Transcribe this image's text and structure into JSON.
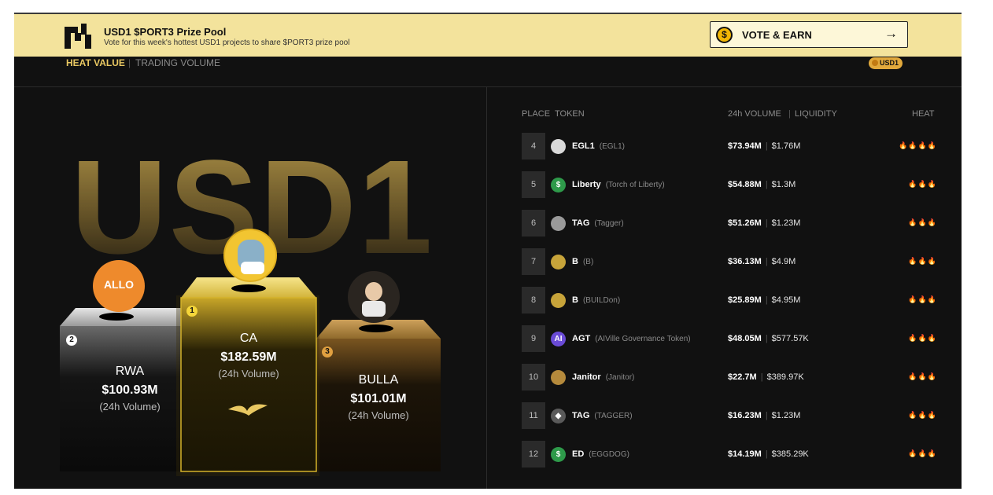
{
  "banner": {
    "title": "USD1 $PORT3 Prize Pool",
    "subtitle": "Vote for this week's hottest USD1 projects to share $PORT3 prize pool",
    "vote_coin": "$",
    "vote_label": "VOTE & EARN",
    "vote_arrow": "→"
  },
  "tabs": {
    "heat": "HEAT VALUE",
    "separator": "|",
    "volume": "TRADING VOLUME"
  },
  "badge": {
    "label": "USD1"
  },
  "hero_text": "USD1",
  "podium": [
    {
      "rank": "2",
      "name": "RWA",
      "value": "$100.93M",
      "sub": "(24h Volume)",
      "avatar_text": "ALLO"
    },
    {
      "rank": "1",
      "name": "CA",
      "value": "$182.59M",
      "sub": "(24h Volume)"
    },
    {
      "rank": "3",
      "name": "BULLA",
      "value": "$101.01M",
      "sub": "(24h Volume)"
    }
  ],
  "colors": {
    "banner_bg": "#f3e39c",
    "accent_gold": "#e9c862",
    "heat": "#f07a1c"
  },
  "table": {
    "headers": {
      "place": "PLACE",
      "token": "TOKEN",
      "volume": "24h VOLUME",
      "sep": "|",
      "liquidity": "LIQUIDITY",
      "heat": "HEAT"
    },
    "rows": [
      {
        "place": "4",
        "icon": "eagle-icon",
        "icon_color": "#d9d9d9",
        "icon_glyph": "",
        "symbol": "EGL1",
        "full": "(EGL1)",
        "volume": "$73.94M",
        "liquidity": "$1.76M",
        "heat": "🔥🔥🔥🔥"
      },
      {
        "place": "5",
        "icon": "dollar-icon",
        "icon_color": "#2e9a4a",
        "icon_glyph": "$",
        "symbol": "Liberty",
        "full": "(Torch of Liberty)",
        "volume": "$54.88M",
        "liquidity": "$1.3M",
        "heat": "🔥🔥🔥"
      },
      {
        "place": "6",
        "icon": "robot-icon",
        "icon_color": "#9a9a9a",
        "icon_glyph": "",
        "symbol": "TAG",
        "full": "(Tagger)",
        "volume": "$51.26M",
        "liquidity": "$1.23M",
        "heat": "🔥🔥🔥"
      },
      {
        "place": "7",
        "icon": "builder-icon",
        "icon_color": "#c7a43a",
        "icon_glyph": "",
        "symbol": "B",
        "full": "(B)",
        "volume": "$36.13M",
        "liquidity": "$4.9M",
        "heat": "🔥🔥🔥"
      },
      {
        "place": "8",
        "icon": "builder-icon",
        "icon_color": "#c7a43a",
        "icon_glyph": "",
        "symbol": "B",
        "full": "(BUILDon)",
        "volume": "$25.89M",
        "liquidity": "$4.95M",
        "heat": "🔥🔥🔥"
      },
      {
        "place": "9",
        "icon": "agt-icon",
        "icon_color": "#6a4bd6",
        "icon_glyph": "AI",
        "symbol": "AGT",
        "full": "(AIVille Governance Token)",
        "volume": "$48.05M",
        "liquidity": "$577.57K",
        "heat": "🔥🔥🔥"
      },
      {
        "place": "10",
        "icon": "janitor-icon",
        "icon_color": "#b58a3c",
        "icon_glyph": "",
        "symbol": "Janitor",
        "full": "(Janitor)",
        "volume": "$22.7M",
        "liquidity": "$389.97K",
        "heat": "🔥🔥🔥"
      },
      {
        "place": "11",
        "icon": "diamond-icon",
        "icon_color": "#5a5a5a",
        "icon_glyph": "◆",
        "symbol": "TAG",
        "full": "(TAGGER)",
        "volume": "$16.23M",
        "liquidity": "$1.23M",
        "heat": "🔥🔥🔥"
      },
      {
        "place": "12",
        "icon": "dollar-icon",
        "icon_color": "#2e9a4a",
        "icon_glyph": "$",
        "symbol": "ED",
        "full": "(EGGDOG)",
        "volume": "$14.19M",
        "liquidity": "$385.29K",
        "heat": "🔥🔥🔥"
      }
    ]
  }
}
